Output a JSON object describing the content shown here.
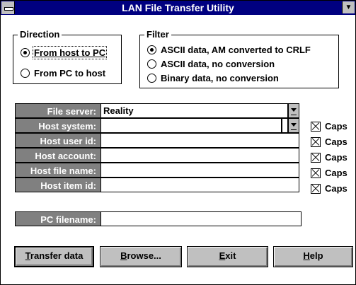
{
  "window": {
    "title": "LAN File Transfer Utility"
  },
  "direction": {
    "legend": "Direction",
    "options": [
      {
        "label": "From host to PC",
        "selected": true
      },
      {
        "label": "From PC to host",
        "selected": false
      }
    ]
  },
  "filter": {
    "legend": "Filter",
    "options": [
      {
        "label": "ASCII data, AM converted to CRLF",
        "selected": true
      },
      {
        "label": "ASCII data, no conversion",
        "selected": false
      },
      {
        "label": "Binary data, no conversion",
        "selected": false
      }
    ]
  },
  "fields": {
    "file_server": {
      "label": "File server:",
      "value": "Reality"
    },
    "host_system": {
      "label": "Host system:",
      "value": ""
    },
    "host_user_id": {
      "label": "Host user id:",
      "value": ""
    },
    "host_account": {
      "label": "Host account:",
      "value": ""
    },
    "host_file_name": {
      "label": "Host file name:",
      "value": ""
    },
    "host_item_id": {
      "label": "Host item id:",
      "value": ""
    },
    "pc_filename": {
      "label": "PC filename:",
      "value": ""
    }
  },
  "caps_label": "Caps",
  "buttons": {
    "transfer": {
      "first": "T",
      "rest": "ransfer data"
    },
    "browse": {
      "first": "B",
      "rest": "rowse..."
    },
    "exit": {
      "first": "E",
      "rest": "xit"
    },
    "help": {
      "first": "H",
      "rest": "elp"
    }
  }
}
